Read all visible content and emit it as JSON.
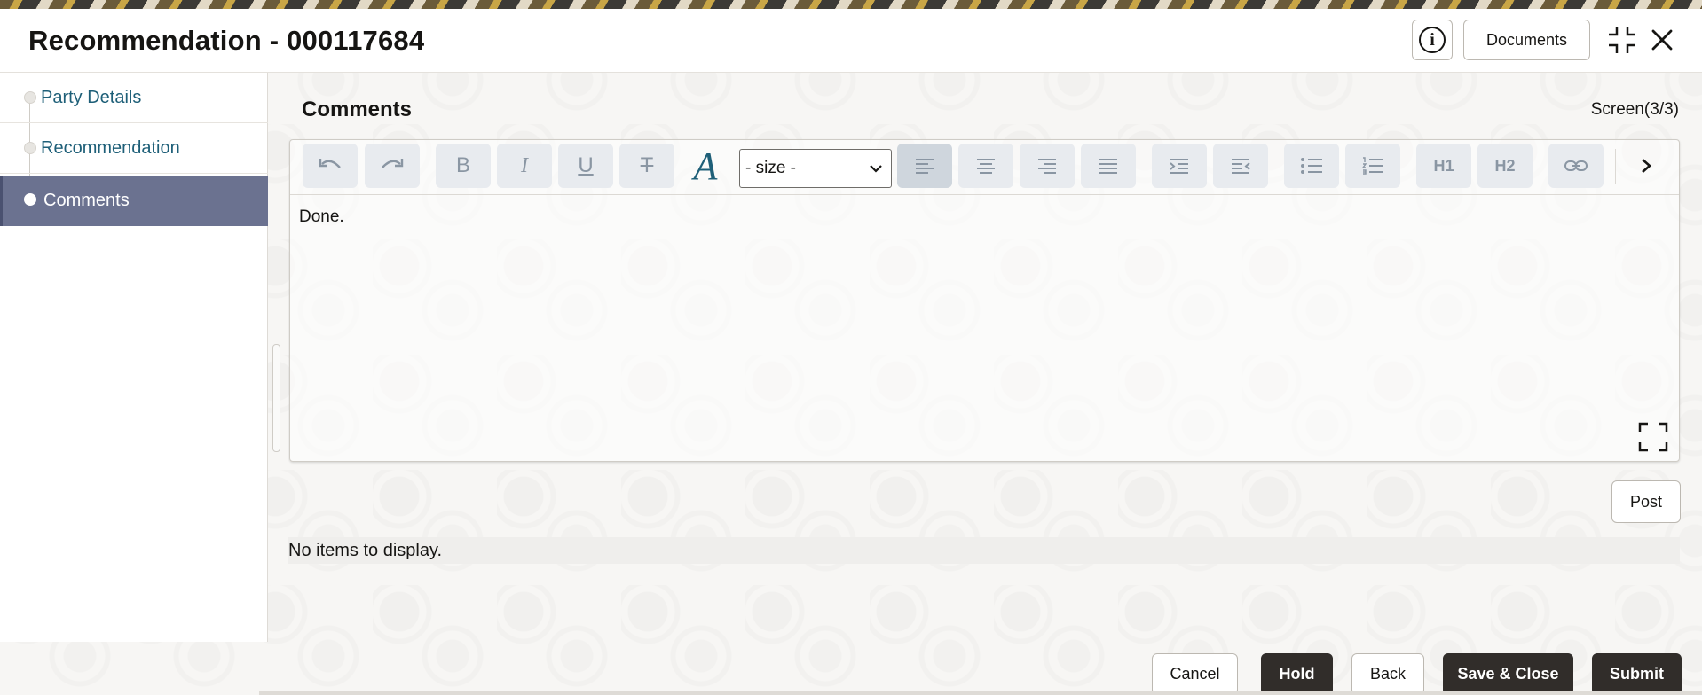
{
  "header": {
    "title": "Recommendation - 000117684",
    "info_icon": "info-icon",
    "documents_label": "Documents"
  },
  "sidebar": {
    "items": [
      {
        "label": "Party Details",
        "active": false
      },
      {
        "label": "Recommendation",
        "active": false
      },
      {
        "label": "Comments",
        "active": true
      }
    ]
  },
  "main": {
    "section_title": "Comments",
    "screen_count": "Screen(3/3)",
    "editor": {
      "size_select": "- size -",
      "toolbar": {
        "bold": "B",
        "italic": "I",
        "underline": "U",
        "strikethrough": "T",
        "font_color": "A",
        "h1": "H1",
        "h2": "H2"
      },
      "content": "Done."
    },
    "post_label": "Post",
    "empty_message": "No items to display."
  },
  "footer": {
    "cancel": "Cancel",
    "hold": "Hold",
    "back": "Back",
    "save_close": "Save & Close",
    "submit": "Submit"
  },
  "colors": {
    "active_nav": "#6b7290",
    "link": "#1e5f78",
    "dark_button": "#312d2a",
    "toolbar_button": "#e8ebef"
  }
}
